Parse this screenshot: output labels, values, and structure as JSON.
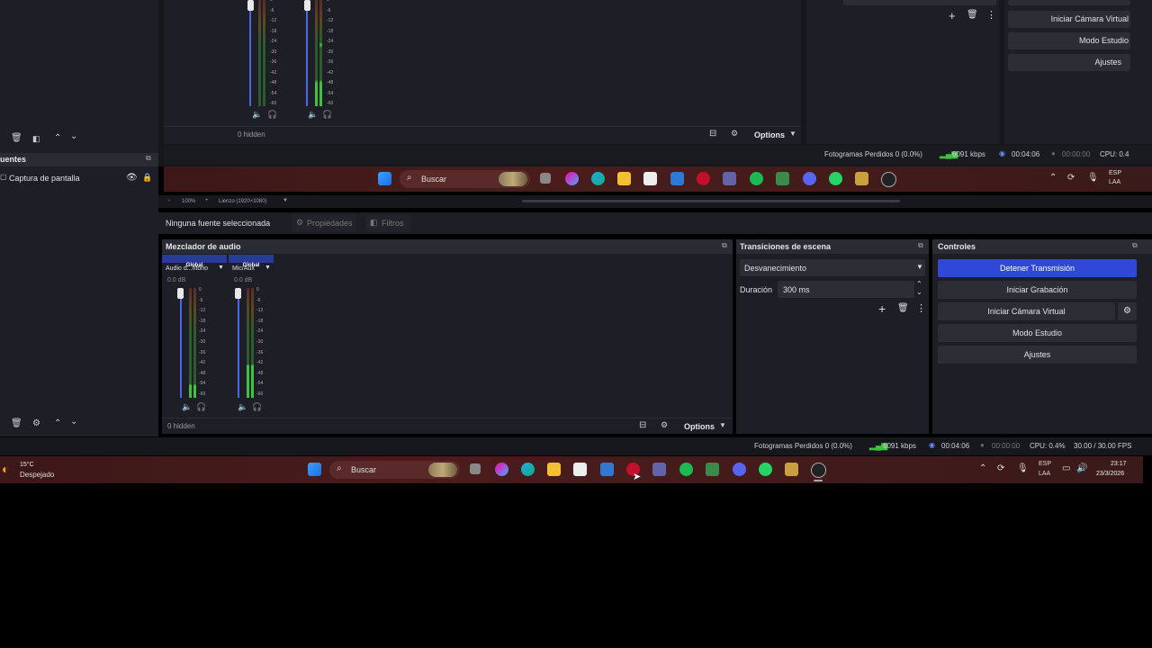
{
  "top_capture": {
    "hidden_label": "0 hidden",
    "options_label": "Options",
    "scene_controls": [
      "Iniciar Cámara Virtual",
      "Modo Estudio",
      "Ajustes"
    ],
    "scale_labels": [
      "0",
      "-6",
      "-12",
      "-18",
      "-24",
      "-30",
      "-36",
      "-42",
      "-48",
      "-54",
      "-60"
    ],
    "status": {
      "frames_lost": "Fotogramas Perdidos 0 (0.0%)",
      "kbps": "6091 kbps",
      "stream_time": "00:04:06",
      "rec_time": "00:00:00",
      "cpu": "CPU: 0.4"
    },
    "sources_title": "uentes",
    "source_item": "Captura de pantalla",
    "taskbar": {
      "search": "Buscar",
      "lang": "ESP",
      "lang2": "LAA"
    }
  },
  "zoom_bar": {
    "zoom": "100%",
    "canvas": "Lienzo (1920×1080)"
  },
  "properties_bar": {
    "no_source": "Ninguna fuente seleccionada",
    "properties": "Propiedades",
    "filters": "Filtros"
  },
  "audio_mixer": {
    "title": "Mezclador de audio",
    "channels": [
      {
        "global": "Global",
        "name": "Audio d...ritorio",
        "db": "0.0 dB",
        "level": 0.12
      },
      {
        "global": "Global",
        "name": "Mic/Aux",
        "db": "0.0 dB",
        "level": 0.3
      }
    ],
    "hidden_label": "0 hidden",
    "options_label": "Options"
  },
  "transitions": {
    "title": "Transiciones de escena",
    "selected": "Desvanecimiento",
    "duration_label": "Duración",
    "duration_value": "300 ms"
  },
  "controls": {
    "title": "Controles",
    "buttons": {
      "stop_stream": "Detener Transmisión",
      "start_recording": "Iniciar Grabación",
      "start_virtual_cam": "Iniciar Cámara Virtual",
      "studio_mode": "Modo Estudio",
      "settings": "Ajustes"
    }
  },
  "status_bar": {
    "frames_lost": "Fotogramas Perdidos 0 (0.0%)",
    "kbps": "6091 kbps",
    "stream_time": "00:04:06",
    "rec_time": "00:00:00",
    "cpu": "CPU: 0.4%",
    "fps": "30.00 / 30.00 FPS"
  },
  "taskbar": {
    "weather_temp": "15°C",
    "weather_desc": "Despejado",
    "search": "Buscar",
    "lang": "ESP",
    "lang2": "LAA",
    "time": "23:17",
    "date": "23/3/2026"
  },
  "colors": {
    "accent_blue": "#2f48d6",
    "meter_green": "#3cc43c",
    "meter_dim_green": "#2e5a2e",
    "taskbar_red": "#4a1c1c"
  }
}
